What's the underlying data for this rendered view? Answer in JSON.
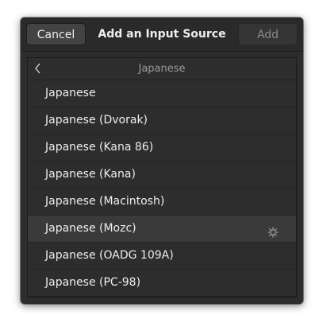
{
  "dialog": {
    "title": "Add an Input Source",
    "cancel_label": "Cancel",
    "add_label": "Add"
  },
  "list": {
    "header_title": "Japanese",
    "back_icon": "chevron-left-icon",
    "rows": [
      {
        "label": "Japanese"
      },
      {
        "label": "Japanese (Dvorak)"
      },
      {
        "label": "Japanese (Kana 86)"
      },
      {
        "label": "Japanese (Kana)"
      },
      {
        "label": "Japanese (Macintosh)"
      },
      {
        "label": "Japanese (Mozc)",
        "selected": true,
        "icon": "gear-icon"
      },
      {
        "label": "Japanese (OADG 109A)"
      },
      {
        "label": "Japanese (PC-98)"
      }
    ]
  },
  "colors": {
    "dialog_bg": "#2d2d2d",
    "text": "#eeeeec",
    "muted_text": "#9a9a9a",
    "selected_row_bg": "#3a3a3a"
  }
}
